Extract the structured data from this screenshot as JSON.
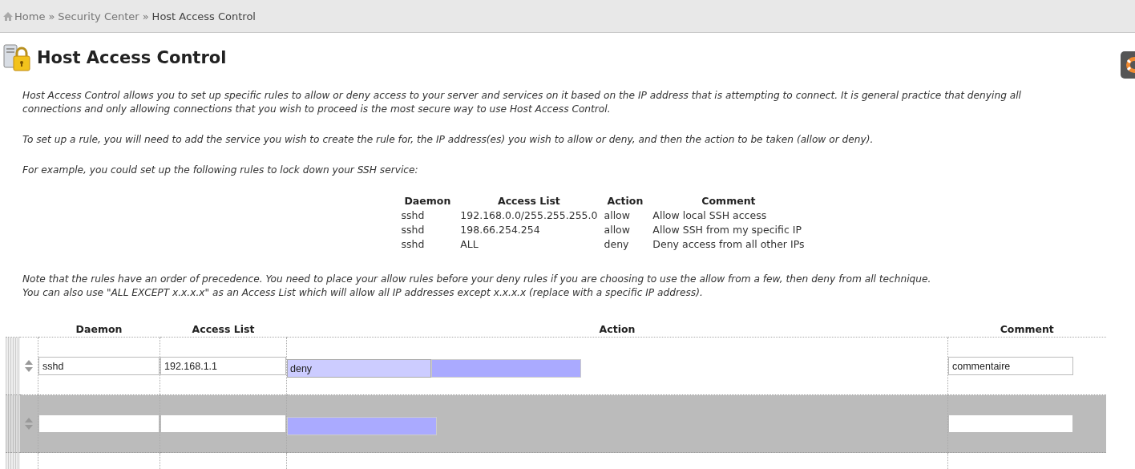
{
  "breadcrumb": [
    {
      "label": "Home",
      "kind": "home"
    },
    {
      "label": "»",
      "kind": "sep"
    },
    {
      "label": "Security Center",
      "kind": "link"
    },
    {
      "label": "»",
      "kind": "sep"
    },
    {
      "label": "Host Access Control",
      "kind": "current"
    }
  ],
  "title": "Host Access Control",
  "intro": [
    "Host Access Control allows you to set up specific rules to allow or deny access to your server and services on it based on the IP address that is attempting to connect. It is general practice that denying all connections and only allowing connections that you wish to proceed is the most secure way to use Host Access Control.",
    "To set up a rule, you will need to add the service you wish to create the rule for, the IP address(es) you wish to allow or deny, and then the action to be taken (allow or deny).",
    "For example, you could set up the following rules to lock down your SSH service:"
  ],
  "example": {
    "columns": [
      "Daemon",
      "Access List",
      "Action",
      "Comment"
    ],
    "rows": [
      [
        "sshd",
        "192.168.0.0/255.255.255.0",
        "allow",
        "Allow local SSH access"
      ],
      [
        "sshd",
        "198.66.254.254",
        "allow",
        "Allow SSH from my specific IP"
      ],
      [
        "sshd",
        "ALL",
        "deny",
        "Deny access from all other IPs"
      ]
    ]
  },
  "notes": [
    "Note that the rules have an order of precedence. You need to place your allow rules before your deny rules if you are choosing to use the allow from a few, then deny from all technique.",
    "You can also use \"ALL EXCEPT x.x.x.x\" as an Access List which will allow all IP addresses except x.x.x.x (replace with a specific IP address)."
  ],
  "rules": {
    "columns": [
      "Daemon",
      "Access List",
      "Action",
      "Comment"
    ],
    "rows": [
      {
        "daemon": "sshd",
        "access_list": "192.168.1.1",
        "action": "deny",
        "comment": "commentaire",
        "highlighted": false
      },
      {
        "highlighted": true
      }
    ]
  }
}
